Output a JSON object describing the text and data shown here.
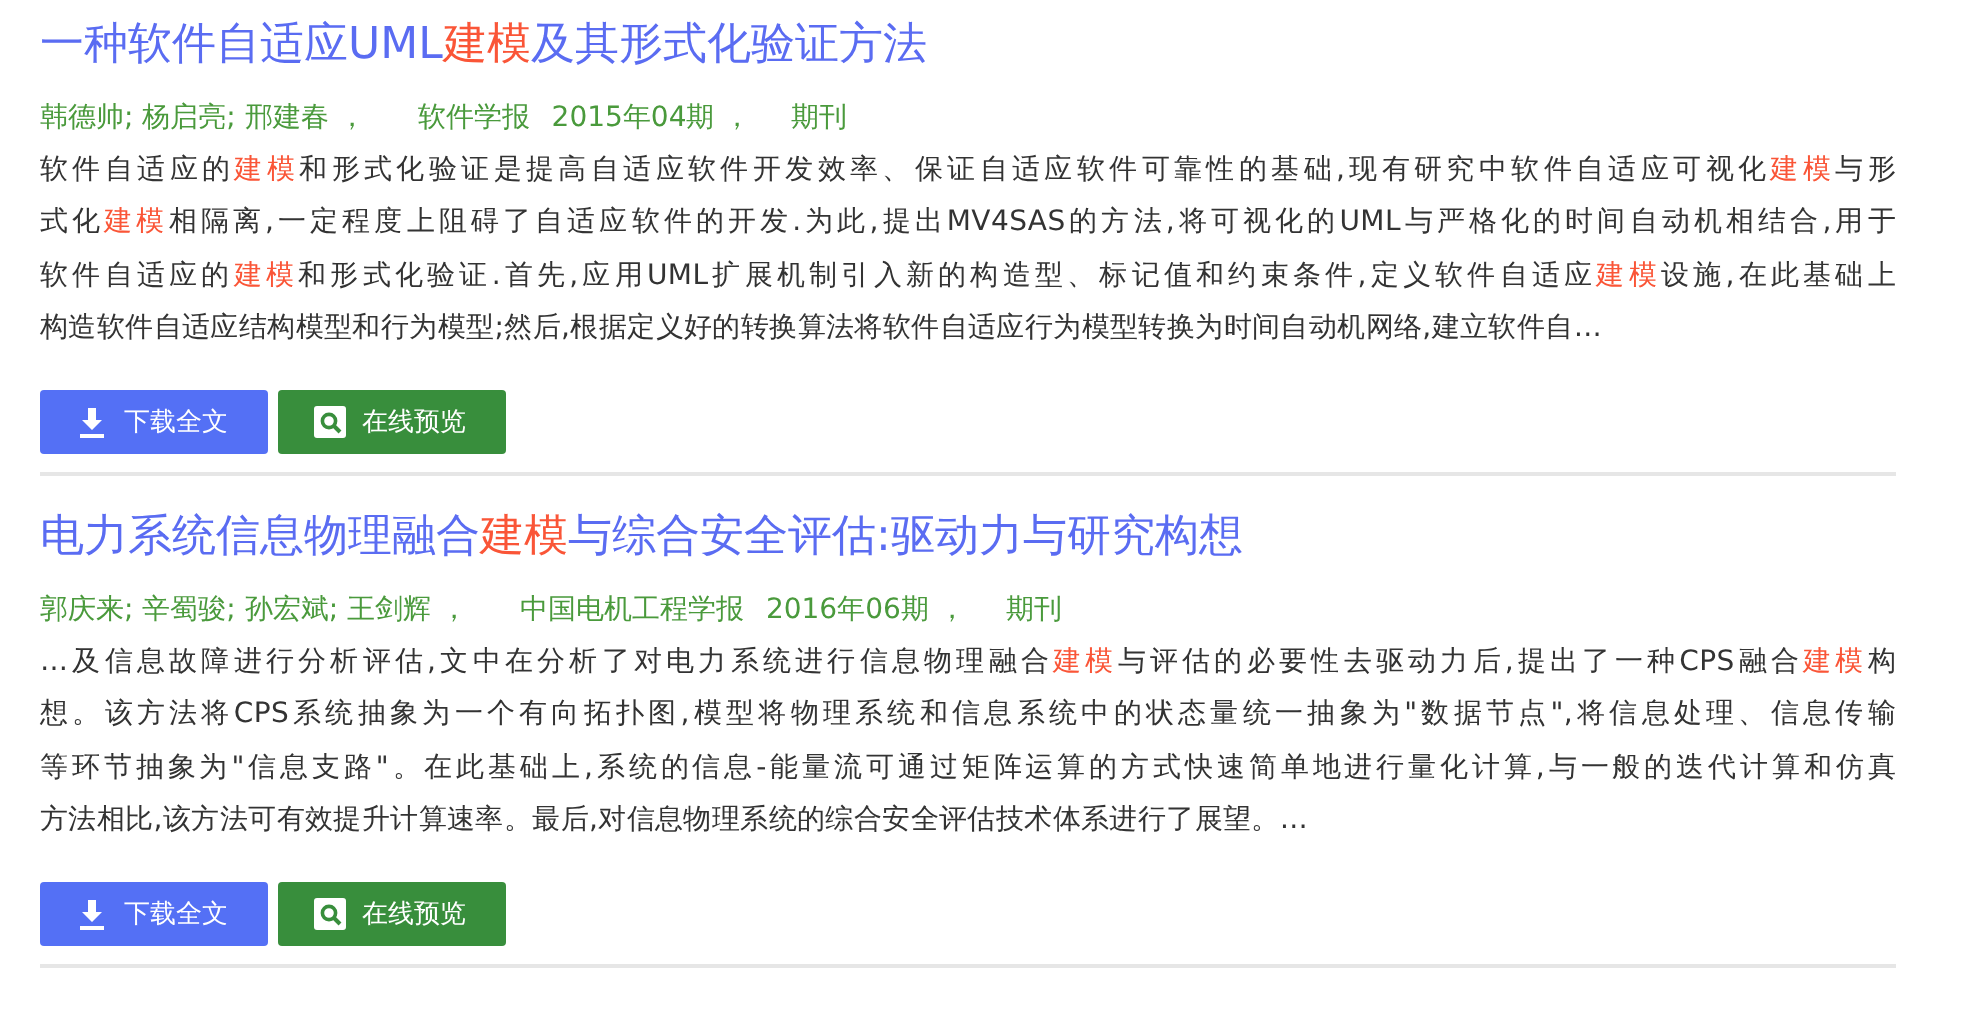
{
  "articles": [
    {
      "title": [
        {
          "text": "一种软件自适应UML",
          "highlight": false
        },
        {
          "text": "建模",
          "highlight": true
        },
        {
          "text": "及其形式化验证方法",
          "highlight": false
        }
      ],
      "authors": "韩德帅; 杨启亮; 邢建春 ，",
      "journal": "软件学报",
      "issue": "2015年04期 ，",
      "type": "期刊",
      "abstract_lines": [
        [
          {
            "text": "软件自适应的",
            "highlight": false
          },
          {
            "text": "建模",
            "highlight": true
          },
          {
            "text": "和形式化验证是提高自适应软件开发效率、保证自适应软件可靠性的基础,现有研究中软件自适应可视化",
            "highlight": false
          },
          {
            "text": "建模",
            "highlight": true
          },
          {
            "text": "与形",
            "highlight": false
          }
        ],
        [
          {
            "text": "式化",
            "highlight": false
          },
          {
            "text": "建模",
            "highlight": true
          },
          {
            "text": "相隔离,一定程度上阻碍了自适应软件的开发.为此,提出MV4SAS的方法,将可视化的UML与严格化的时间自动机相结合,用于",
            "highlight": false
          }
        ],
        [
          {
            "text": "软件自适应的",
            "highlight": false
          },
          {
            "text": "建模",
            "highlight": true
          },
          {
            "text": "和形式化验证.首先,应用UML扩展机制引入新的构造型、标记值和约束条件,定义软件自适应",
            "highlight": false
          },
          {
            "text": "建模",
            "highlight": true
          },
          {
            "text": "设施,在此基础上",
            "highlight": false
          }
        ],
        [
          {
            "text": "构造软件自适应结构模型和行为模型;然后,根据定义好的转换算法将软件自适应行为模型转换为时间自动机网络,建立软件自…",
            "highlight": false
          }
        ]
      ],
      "download_label": "下载全文",
      "preview_label": "在线预览"
    },
    {
      "title": [
        {
          "text": "电力系统信息物理融合",
          "highlight": false
        },
        {
          "text": "建模",
          "highlight": true
        },
        {
          "text": "与综合安全评估:驱动力与研究构想",
          "highlight": false
        }
      ],
      "authors": "郭庆来; 辛蜀骏; 孙宏斌; 王剑辉 ，",
      "journal": "中国电机工程学报",
      "issue": "2016年06期 ，",
      "type": "期刊",
      "abstract_lines": [
        [
          {
            "text": "…及信息故障进行分析评估,文中在分析了对电力系统进行信息物理融合",
            "highlight": false
          },
          {
            "text": "建模",
            "highlight": true
          },
          {
            "text": "与评估的必要性去驱动力后,提出了一种CPS融合",
            "highlight": false
          },
          {
            "text": "建模",
            "highlight": true
          },
          {
            "text": "构",
            "highlight": false
          }
        ],
        [
          {
            "text": "想。该方法将CPS系统抽象为一个有向拓扑图,模型将物理系统和信息系统中的状态量统一抽象为\"数据节点\",将信息处理、信息传输",
            "highlight": false
          }
        ],
        [
          {
            "text": "等环节抽象为\"信息支路\"。在此基础上,系统的信息-能量流可通过矩阵运算的方式快速简单地进行量化计算,与一般的迭代计算和仿真",
            "highlight": false
          }
        ],
        [
          {
            "text": "方法相比,该方法可有效提升计算速率。最后,对信息物理系统的综合安全评估技术体系进行了展望。…",
            "highlight": false
          }
        ]
      ],
      "download_label": "下载全文",
      "preview_label": "在线预览"
    }
  ]
}
